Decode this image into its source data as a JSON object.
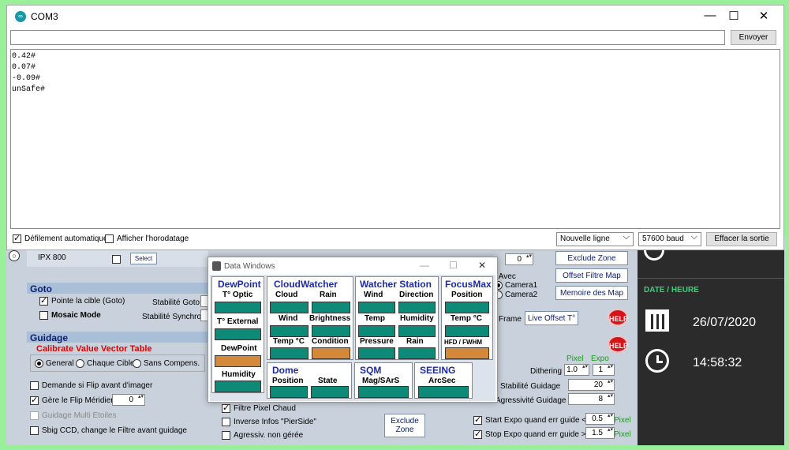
{
  "serial_monitor": {
    "title": "COM3",
    "icon": "arduino-icon",
    "minimize": "—",
    "maximize": "☐",
    "close": "✕",
    "input_value": "",
    "send_label": "Envoyer",
    "output_lines": [
      "0.42#",
      "0.07#",
      "-0.09#",
      "unSafe#"
    ],
    "autoscroll_label": "Défilement automatique",
    "autoscroll_checked": true,
    "timestamp_label": "Afficher l'horodatage",
    "timestamp_checked": false,
    "line_ending": "Nouvelle ligne",
    "baud_rate": "57600 baud",
    "clear_label": "Effacer la sortie"
  },
  "data_windows": {
    "title": "Data Windows",
    "minimize": "—",
    "maximize": "☐",
    "close": "✕",
    "dewpoint": {
      "header": "DewPoint",
      "t_optic": "T° Optic",
      "t_external": "T° External",
      "dewpoint": "DewPoint",
      "humidity": "Humidity"
    },
    "cloudwatcher": {
      "header": "CloudWatcher",
      "cloud": "Cloud",
      "rain": "Rain",
      "wind": "Wind",
      "brightness": "Brightness",
      "temp": "Temp °C",
      "condition": "Condition"
    },
    "watcher_station": {
      "header": "Watcher Station",
      "wind": "Wind",
      "direction": "Direction",
      "temp": "Temp",
      "humidity": "Humidity",
      "pressure": "Pressure",
      "rain": "Rain"
    },
    "focusmax": {
      "header": "FocusMax",
      "position": "Position",
      "temp": "Temp °C",
      "hfd": "HFD / FWHM"
    },
    "dome": {
      "header": "Dome",
      "position": "Position",
      "state": "State"
    },
    "sqm": {
      "header": "SQM",
      "mag": "Mag/SArS"
    },
    "seeing": {
      "header": "SEEING",
      "arcsec": "ArcSec"
    },
    "colors": {
      "teal": "#0d8a78",
      "orange": "#d4893a",
      "header": "#1d2aa5"
    }
  },
  "background_app": {
    "ipx_label": "IPX 800",
    "select_btn": "Select",
    "goto_title": "Goto",
    "pointe_label": "Pointe la cible (Goto)",
    "stab_goto_label": "Stabilité Goto",
    "mosaic_label": "Mosaic Mode",
    "stab_synchro_label": "Stabilité Synchro",
    "guidage_title": "Guidage",
    "calibrate_label": "Calibrate Value Vector Table",
    "general_label": "General",
    "chaque_label": "Chaque Cible",
    "sans_label": "Sans Compens.",
    "flip_label": "Demande si Flip avant d'imager",
    "gere_flip_label": "Gère le Flip Méridien",
    "gere_flip_value": "0",
    "multi_label": "Guidage Multi Etoiles",
    "sbig_label": "Sbig CCD, change le Filtre avant guidage",
    "filtre_pixel_label": "Filtre Pixel Chaud",
    "inverse_label": "Inverse Infos \"PierSide\"",
    "agressiv_label": "Agressiv.  non gérée",
    "exclude_zone_btn": "Exclude Zone",
    "exclude_zone2_btn": "Exclude\nZone",
    "offset_filtre_btn": "Offset Filtre Map",
    "memoire_btn": "Memoire des Map",
    "live_offset_btn": "Live Offset T°",
    "frame_label": "Frame",
    "map_avec_label": "p Avec",
    "camera1_label": "Camera1",
    "camera2_label": "Camera2",
    "top_spin_value": "0",
    "help_label": "HELP",
    "pixel_label": "Pixel",
    "expo_label": "Expo",
    "dithering_label": "Dithering",
    "dither_pixel": "1.0",
    "dither_expo": "1",
    "stab_guidage_label": "is Stabilité Guidage",
    "stab_guidage_value": "20",
    "agress_guidage_label": "Agressivité Guidage",
    "agress_guidage_value": "8",
    "start_expo_label": "Start Expo quand err guide <",
    "start_expo_value": "0.5",
    "stop_expo_label": "Stop Expo quand  err guide >",
    "stop_expo_value": "1.5",
    "pixel_unit": "Pixel"
  },
  "right_panel": {
    "title": "DATE / HEURE",
    "date": "26/07/2020",
    "time": "14:58:32",
    "colors": {
      "title": "#3bd07a",
      "bg": "#2b2b2b"
    }
  }
}
